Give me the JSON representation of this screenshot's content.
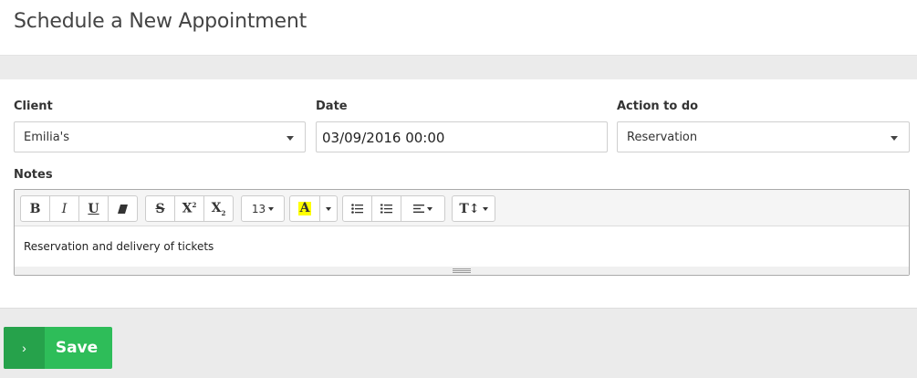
{
  "header": {
    "title": "Schedule a New Appointment"
  },
  "form": {
    "client": {
      "label": "Client",
      "value": "Emilia's"
    },
    "date": {
      "label": "Date",
      "value": "03/09/2016 00:00"
    },
    "action": {
      "label": "Action to do",
      "value": "Reservation"
    },
    "notes": {
      "label": "Notes",
      "content": "Reservation and delivery of tickets",
      "font_size": "13"
    }
  },
  "toolbar_icons": [
    "bold-icon",
    "italic-icon",
    "underline-icon",
    "eraser-icon",
    "strikethrough-icon",
    "superscript-icon",
    "subscript-icon",
    "font-size-dropdown",
    "highlight-color-icon",
    "color-dropdown-caret",
    "bullet-list-icon",
    "numbered-list-icon",
    "align-dropdown-icon",
    "line-height-dropdown-icon"
  ],
  "colors": {
    "save_green": "#2ebd59",
    "save_green_dark": "#26a24b",
    "highlight_yellow": "#ffff00"
  },
  "actions": {
    "save_label": "Save"
  }
}
